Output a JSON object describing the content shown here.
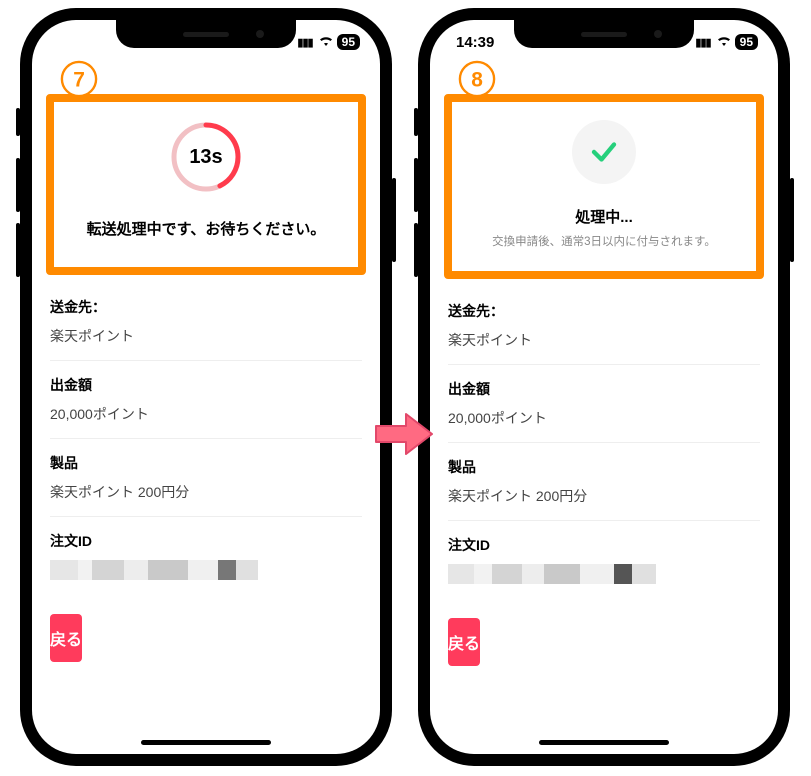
{
  "colors": {
    "accent_orange": "#ff8a00",
    "accent_red": "#ff3b5c",
    "ring_red": "#ff3b4c",
    "check_green": "#26d07c"
  },
  "step_left": "7",
  "step_right": "8",
  "status": {
    "time_left": "",
    "time_right": "14:39",
    "battery": "95"
  },
  "left_card": {
    "countdown": "13s",
    "message": "転送処理中です、お待ちください。"
  },
  "right_card": {
    "title": "処理中...",
    "subtitle": "交換申請後、通常3日以内に付与されます。"
  },
  "sections": {
    "destination_label": "送金先：",
    "destination_value": "楽天ポイント",
    "amount_label": "出金額",
    "amount_value": "20,000ポイント",
    "product_label": "製品",
    "product_value": "楽天ポイント 200円分",
    "order_label": "注文ID"
  },
  "back_button": "戻る"
}
